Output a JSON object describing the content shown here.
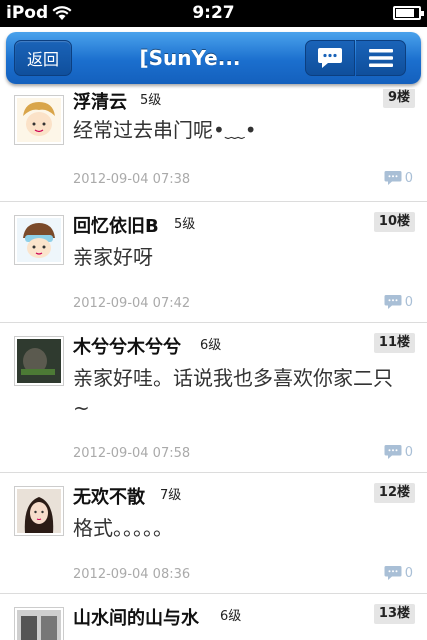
{
  "status_bar": {
    "carrier": "iPod",
    "time": "9:27",
    "battery_level": 0.8
  },
  "nav": {
    "back_label": "返回",
    "title": "[SunYe...",
    "comment_icon": "comment-icon",
    "menu_icon": "menu-icon"
  },
  "posts": [
    {
      "username": "浮清云",
      "level": "5级",
      "floor": "9楼",
      "content": "经常过去串门呢•﹏•",
      "time": "2012-09-04 07:38",
      "replies": "0"
    },
    {
      "username": "回忆依旧B",
      "level": "5级",
      "floor": "10楼",
      "content": "亲家好呀",
      "time": "2012-09-04 07:42",
      "replies": "0"
    },
    {
      "username": "木兮兮木兮兮",
      "level": "6级",
      "floor": "11楼",
      "content": "亲家好哇。话说我也多喜欢你家二只~",
      "time": "2012-09-04 07:58",
      "replies": "0"
    },
    {
      "username": "无欢不散",
      "level": "7级",
      "floor": "12楼",
      "content": "格式。。。。。",
      "time": "2012-09-04 08:36",
      "replies": "0"
    },
    {
      "username": "山水间的山与水",
      "level": "6级",
      "floor": "13楼",
      "content": "",
      "time": "",
      "replies": ""
    }
  ]
}
